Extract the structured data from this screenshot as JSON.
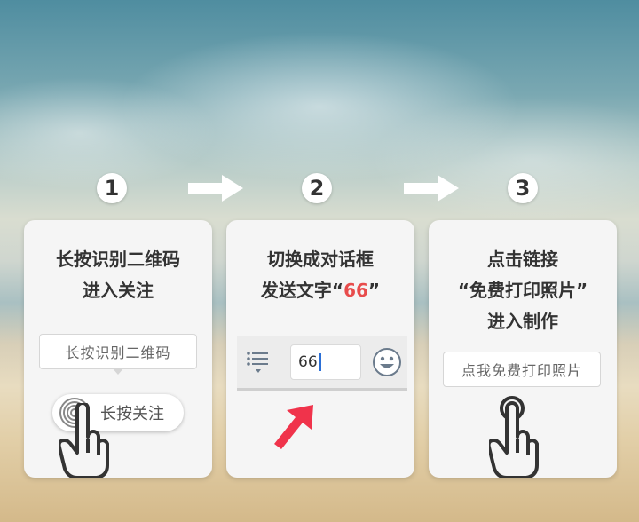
{
  "steps": [
    {
      "number": "1",
      "title_line1": "长按识别二维码",
      "title_line2": "进入关注",
      "qr_box_text": "长按识别二维码",
      "follow_button_label": "长按关注"
    },
    {
      "number": "2",
      "title_line1": "切换成对话框",
      "title_line2_prefix": "发送文字“",
      "title_highlight": "66",
      "title_line2_suffix": "”",
      "chat_input_value": "66"
    },
    {
      "number": "3",
      "title_line1": "点击链接",
      "title_line2": "“免费打印照片”",
      "title_line3": "进入制作",
      "link_box_text": "点我免费打印照片"
    }
  ],
  "icons": {
    "arrow": "right-arrow-icon",
    "menu": "list-menu-icon",
    "emoji": "smiley-icon",
    "pointer": "red-pointer-arrow-icon",
    "hand": "tapping-hand-icon",
    "fingerprint": "fingerprint-icon"
  },
  "colors": {
    "highlight": "#e84c4c",
    "card_bg": "#f5f5f5",
    "pointer": "#f0334b"
  }
}
